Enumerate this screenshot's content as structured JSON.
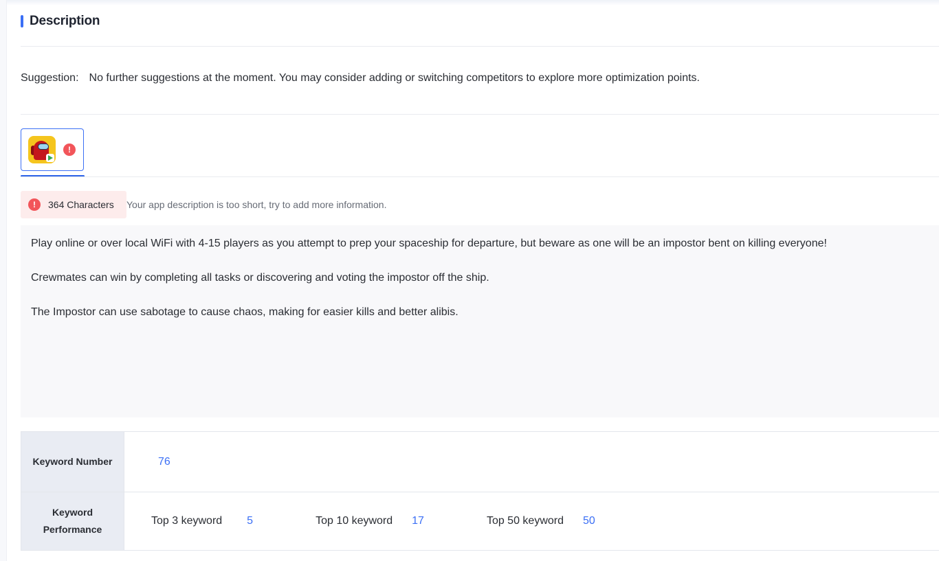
{
  "section": {
    "title": "Description"
  },
  "suggestion": {
    "label": "Suggestion:",
    "text": "No further suggestions at the moment. You may consider adding or switching competitors to explore more optimization points."
  },
  "app_tab": {
    "icon": "among-us-app-icon",
    "alert": "!"
  },
  "characters": {
    "count_label": "364 Characters",
    "hint": "Your app description is too short, try to add more information.",
    "alert": "!"
  },
  "description": {
    "paragraphs": [
      "Play online or over local WiFi with 4-15 players as you attempt to prep your spaceship for departure, but beware as one will be an impostor bent on killing everyone!",
      "Crewmates can win by completing all tasks or discovering and voting the impostor off the ship.",
      "The Impostor can use sabotage to cause chaos, making for easier kills and better alibis."
    ]
  },
  "keywords": {
    "number_label": "Keyword Number",
    "number_value": "76",
    "performance_label_line1": "Keyword",
    "performance_label_line2": "Performance",
    "top3_label": "Top 3 keyword",
    "top3_value": "5",
    "top10_label": "Top 10 keyword",
    "top10_value": "17",
    "top50_label": "Top 50 keyword",
    "top50_value": "50"
  },
  "colors": {
    "accent": "#3b6ff5",
    "alert": "#f2555a",
    "badge_bg": "#fdecec"
  }
}
